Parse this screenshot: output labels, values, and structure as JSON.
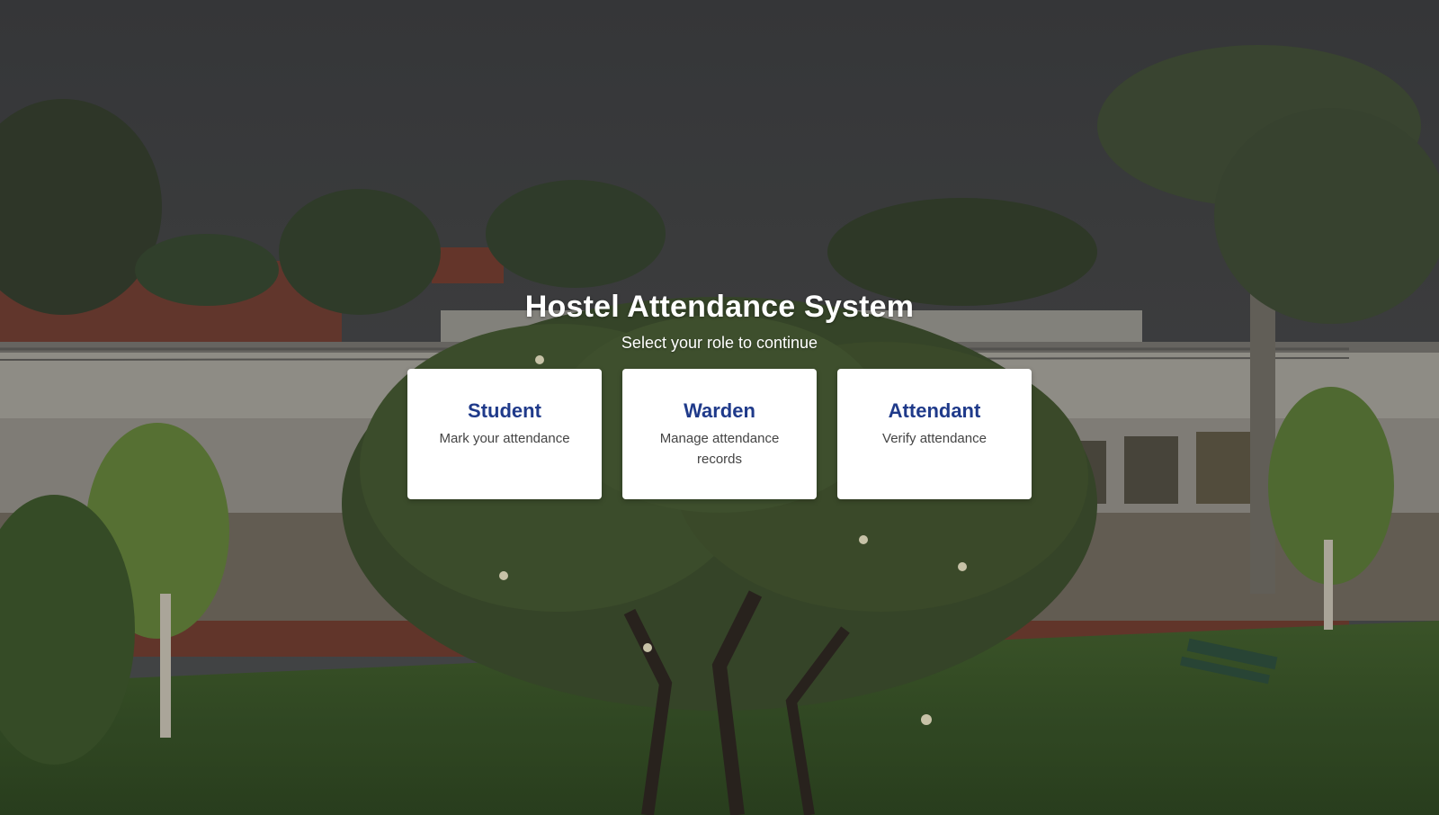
{
  "page": {
    "title": "Hostel Attendance System",
    "subtitle": "Select your role to continue"
  },
  "roles": [
    {
      "title": "Student",
      "description": "Mark your attendance"
    },
    {
      "title": "Warden",
      "description": "Manage attendance records"
    },
    {
      "title": "Attendant",
      "description": "Verify attendance"
    }
  ],
  "colors": {
    "card_title": "#1f3a8a",
    "card_background": "#ffffff",
    "heading_text": "#ffffff"
  }
}
